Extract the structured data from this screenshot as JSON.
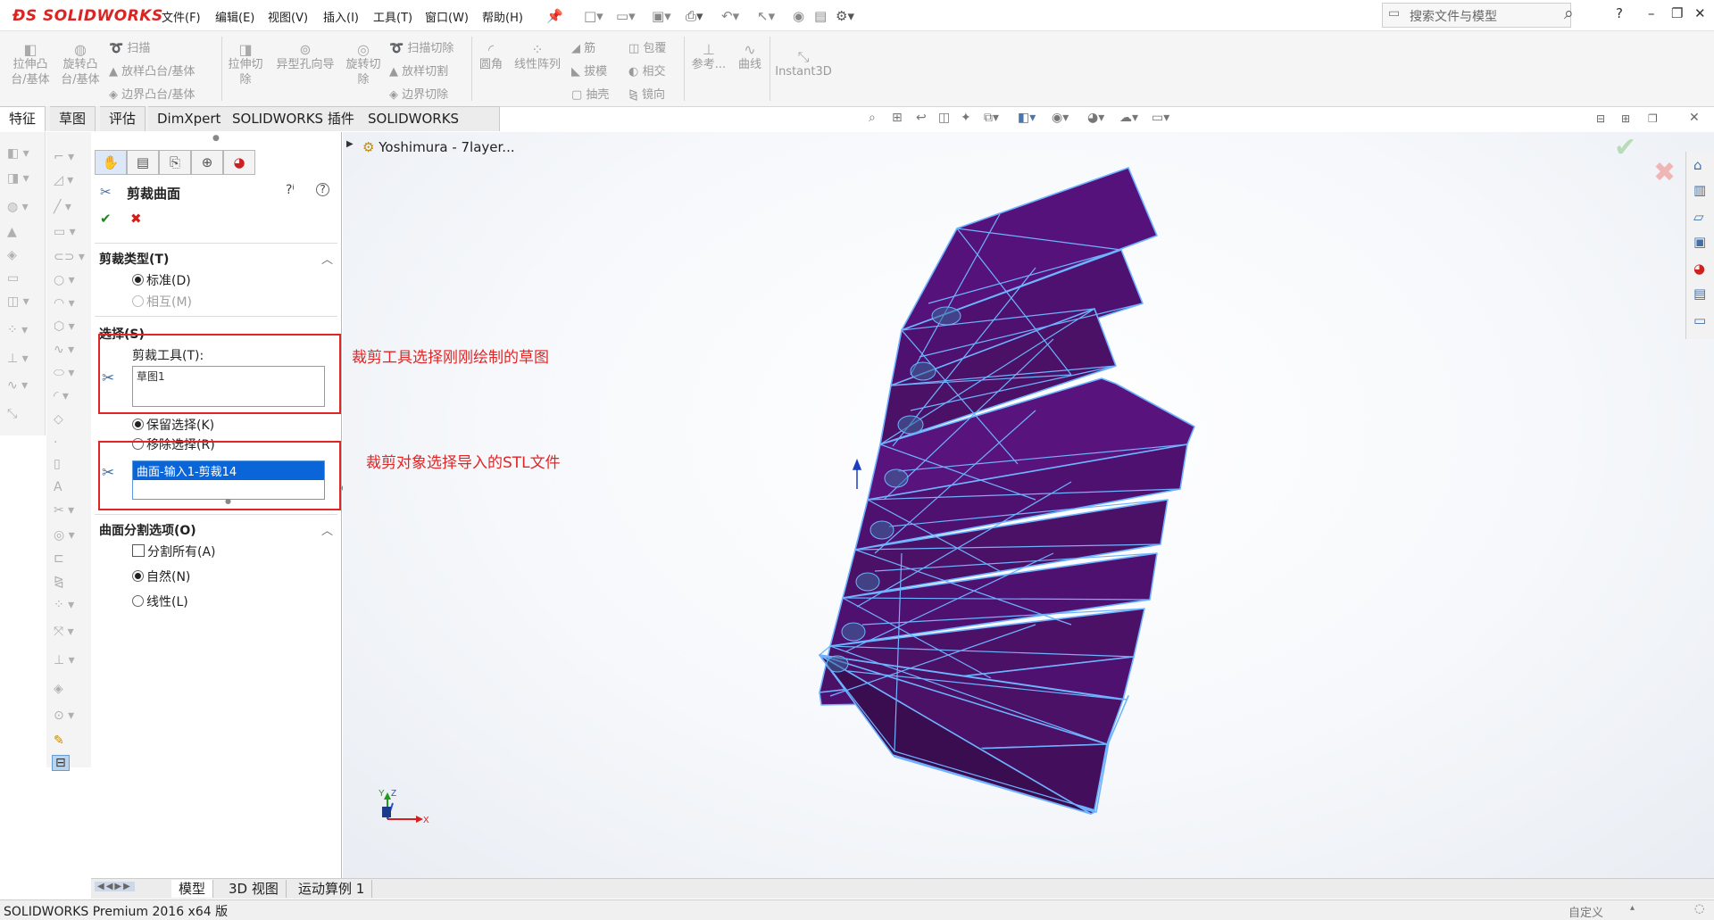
{
  "app": {
    "brand": "SOLIDWORKS"
  },
  "menu": [
    "文件(F)",
    "编辑(E)",
    "视图(V)",
    "插入(I)",
    "工具(T)",
    "窗口(W)",
    "帮助(H)"
  ],
  "search": {
    "placeholder": "搜索文件与模型"
  },
  "window_controls": {
    "help": "?",
    "minimize": "–",
    "restore": "❐",
    "close": "✕"
  },
  "ribbon": {
    "extrude_boss": "拉伸凸台/基体",
    "revolve_boss": "旋转凸台/基体",
    "sweep": "扫描",
    "loft_boss": "放样凸台/基体",
    "boundary_boss": "边界凸台/基体",
    "extrude_cut": "拉伸切除",
    "hole_wizard": "异型孔向导",
    "revolve_cut": "旋转切除",
    "sweep_cut": "扫描切除",
    "loft_cut": "放样切割",
    "boundary_cut": "边界切除",
    "fillet": "圆角",
    "linear_pattern": "线性阵列",
    "rib": "筋",
    "draft": "拔模",
    "shell": "抽壳",
    "wrap": "包覆",
    "intersect": "相交",
    "mirror": "镜向",
    "reference": "参考...",
    "curves": "曲线",
    "instant3d": "Instant3D"
  },
  "tabs": [
    "特征",
    "草图",
    "评估",
    "DimXpert",
    "SOLIDWORKS 插件",
    "SOLIDWORKS MBD"
  ],
  "property_manager": {
    "title": "剪裁曲面",
    "trim_type": {
      "header": "剪裁类型(T)",
      "standard": "标准(D)",
      "mutual": "相互(M)"
    },
    "selections": {
      "header": "选择(S)",
      "trim_tool_label": "剪裁工具(T):",
      "trim_tool_value": "草图1",
      "keep_selections": "保留选择(K)",
      "remove_selections": "移除选择(R)",
      "selected_item": "曲面-输入1-剪裁14"
    },
    "split_options": {
      "header": "曲面分割选项(O)",
      "split_all": "分割所有(A)",
      "natural": "自然(N)",
      "linear": "线性(L)"
    }
  },
  "annotations": {
    "trim_tool": "裁剪工具选择刚刚绘制的草图",
    "trim_target": "裁剪对象选择导入的STL文件"
  },
  "feature_tree": {
    "root": "Yoshimura - 7layer..."
  },
  "bottom_tabs": [
    "模型",
    "3D 视图",
    "运动算例 1"
  ],
  "status": {
    "left": "SOLIDWORKS Premium 2016 x64 版",
    "right": "自定义"
  },
  "colors": {
    "model_fill": "#4b1166",
    "model_edge": "#6fb2ff",
    "accent_red": "#e02525",
    "selection_blue": "#0a66d8"
  }
}
